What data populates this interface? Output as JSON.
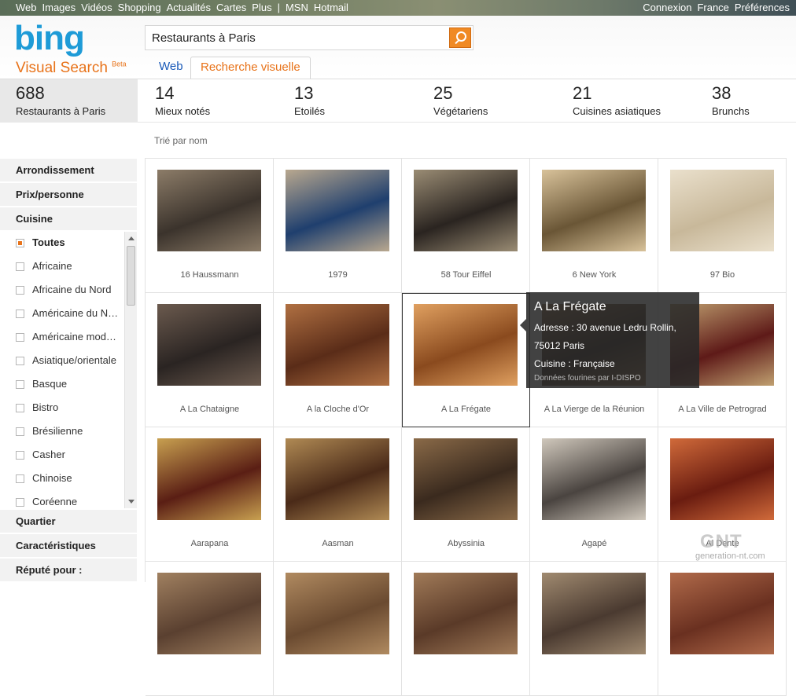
{
  "topnav": {
    "left": [
      "Web",
      "Images",
      "Vidéos",
      "Shopping",
      "Actualités",
      "Cartes",
      "Plus",
      "|",
      "MSN",
      "Hotmail"
    ],
    "right": [
      "Connexion",
      "France",
      "Préférences"
    ]
  },
  "brand": {
    "logo": "bing",
    "product": "Visual Search",
    "badge": "Beta"
  },
  "search": {
    "query": "Restaurants à Paris"
  },
  "tabs": {
    "web": "Web",
    "visual": "Recherche visuelle"
  },
  "stats": [
    {
      "count": "688",
      "label": "Restaurants à Paris"
    },
    {
      "count": "14",
      "label": "Mieux notés"
    },
    {
      "count": "13",
      "label": "Etoilés"
    },
    {
      "count": "25",
      "label": "Végétariens"
    },
    {
      "count": "21",
      "label": "Cuisines asiatiques"
    },
    {
      "count": "38",
      "label": "Brunchs"
    }
  ],
  "sort_label": "Trié par nom",
  "facets": {
    "arrondissement": "Arrondissement",
    "prix": "Prix/personne",
    "cuisine": "Cuisine",
    "quartier": "Quartier",
    "caracteristiques": "Caractéristiques",
    "repute": "Réputé pour :"
  },
  "cuisines": [
    "Toutes",
    "Africaine",
    "Africaine du Nord",
    "Américaine du N…",
    "Américaine mod…",
    "Asiatique/orientale",
    "Basque",
    "Bistro",
    "Brésilienne",
    "Casher",
    "Chinoise",
    "Coréenne"
  ],
  "restaurants": [
    "16 Haussmann",
    "1979",
    "58 Tour Eiffel",
    "6 New York",
    "97 Bio",
    "A La Chataigne",
    "A la Cloche d'Or",
    "A La Frégate",
    "A La Vierge de la Réunion",
    "A La Ville de Petrograd",
    "Aarapana",
    "Aasman",
    "Abyssinia",
    "Agapé",
    "Al Dente",
    "",
    "",
    "",
    "",
    ""
  ],
  "image_palettes": [
    [
      "#3b332c",
      "#8c7c68"
    ],
    [
      "#1f3f6e",
      "#b9a88f"
    ],
    [
      "#2a2420",
      "#9a8c74"
    ],
    [
      "#6a5636",
      "#d8c29a"
    ],
    [
      "#c8b89a",
      "#eae0cc"
    ],
    [
      "#2a2422",
      "#6b5a4e"
    ],
    [
      "#5a2c18",
      "#b07042"
    ],
    [
      "#8a4a1e",
      "#e0a060"
    ],
    [
      "#3a2a20",
      "#a07a52"
    ],
    [
      "#5e1a18",
      "#c0a070"
    ],
    [
      "#5a1e14",
      "#c8a050"
    ],
    [
      "#4a2a18",
      "#b08a54"
    ],
    [
      "#3a2a1e",
      "#8a6a48"
    ],
    [
      "#4a4440",
      "#d0c8bc"
    ],
    [
      "#6a1c10",
      "#d06a3a"
    ],
    [
      "#5a4030",
      "#a08060"
    ],
    [
      "#6a4a30",
      "#b08a60"
    ],
    [
      "#5a3a28",
      "#a07a58"
    ],
    [
      "#4a3a30",
      "#a08a70"
    ],
    [
      "#6a3020",
      "#b06a4a"
    ]
  ],
  "popup": {
    "title": "A La Frégate",
    "address1": "Adresse : 30 avenue Ledru Rollin,",
    "address2": "75012 Paris",
    "cuisine": "Cuisine : Française",
    "source": "Données fourines par I-DISPO"
  },
  "watermark": {
    "main": "GNT",
    "sub": "generation-nt.com"
  }
}
